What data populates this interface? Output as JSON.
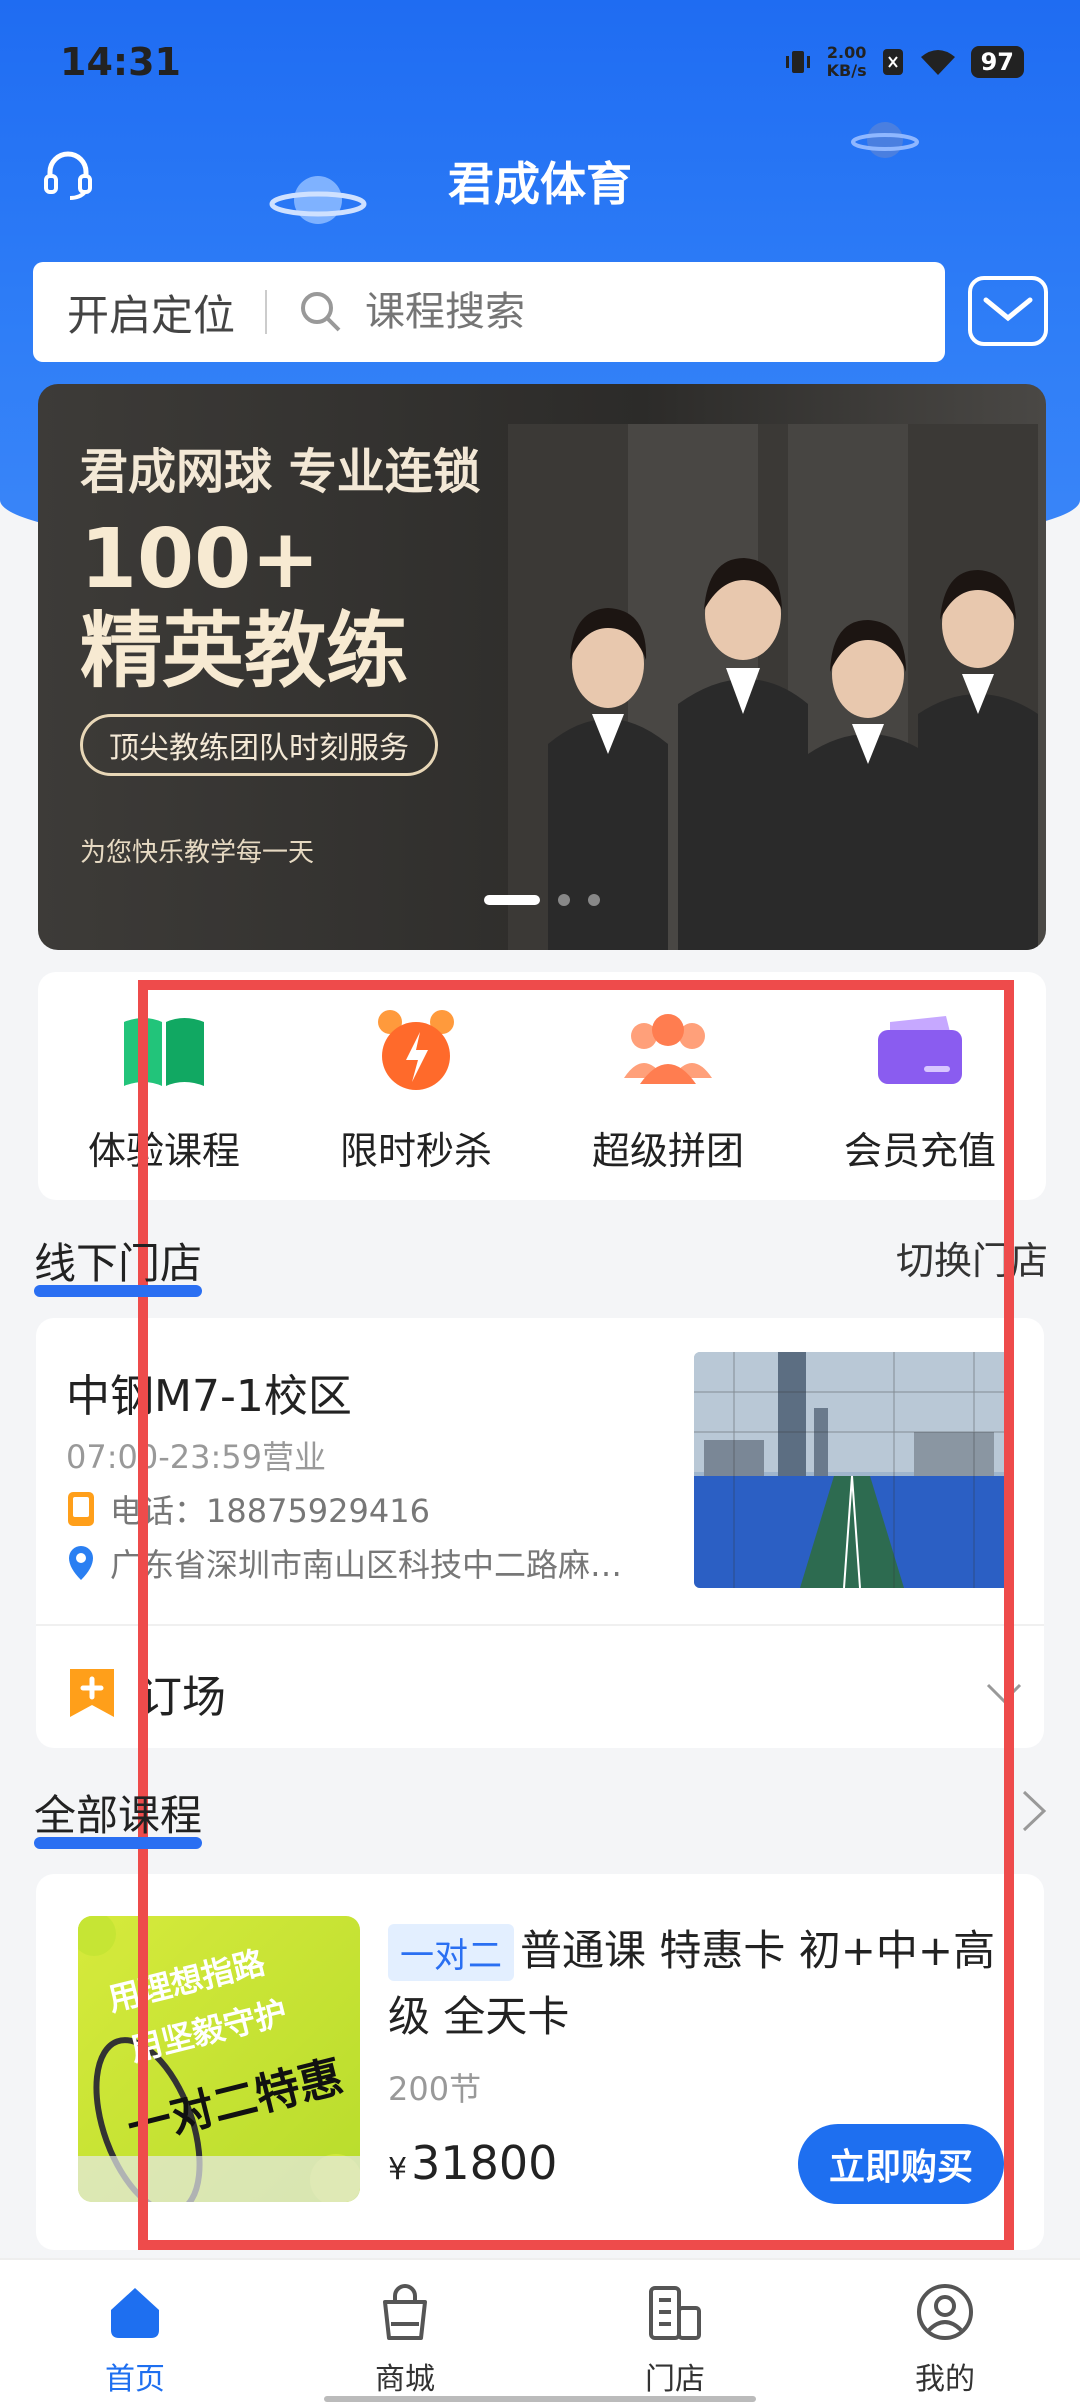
{
  "status_bar": {
    "time": "14:31",
    "net_speed_value": "2.00",
    "net_speed_unit": "KB/s",
    "battery": "97"
  },
  "header": {
    "title": "君成体育"
  },
  "search": {
    "location_label": "开启定位",
    "placeholder": "课程搜索"
  },
  "banner": {
    "line1": "君成网球 专业连锁",
    "big1": "100+",
    "big2": "精英教练",
    "pill": "顶尖教练团队时刻服务",
    "foot": "为您快乐教学每一天"
  },
  "quick_menu": [
    {
      "label": "体验课程",
      "icon": "book-icon"
    },
    {
      "label": "限时秒杀",
      "icon": "alarm-clock-icon"
    },
    {
      "label": "超级拼团",
      "icon": "group-icon"
    },
    {
      "label": "会员充值",
      "icon": "card-icon"
    }
  ],
  "store_section": {
    "title": "线下门店",
    "switch_label": "切换门店"
  },
  "store": {
    "name": "中钢M7-1校区",
    "hours": "07:00-23:59营业",
    "phone": "电话：18875929416",
    "address": "广东省深圳市南山区科技中二路麻…",
    "booking_label": "订场"
  },
  "course_section": {
    "title": "全部课程"
  },
  "course": {
    "image_text1": "用理想指路",
    "image_text2": "用坚毅守护",
    "image_text3": "一对二特惠",
    "tag": "一对二",
    "title": "普通课 特惠卡 初+中+高级 全天卡",
    "sessions": "200节",
    "currency": "¥",
    "price": "31800",
    "buy_label": "立即购买"
  },
  "tab_bar": [
    {
      "label": "首页",
      "active": true
    },
    {
      "label": "商城",
      "active": false
    },
    {
      "label": "门店",
      "active": false
    },
    {
      "label": "我的",
      "active": false
    }
  ],
  "colors": {
    "primary": "#1e6ff0",
    "header_blue": "#2f7ef7",
    "overlay_red": "#ee4b4b"
  }
}
